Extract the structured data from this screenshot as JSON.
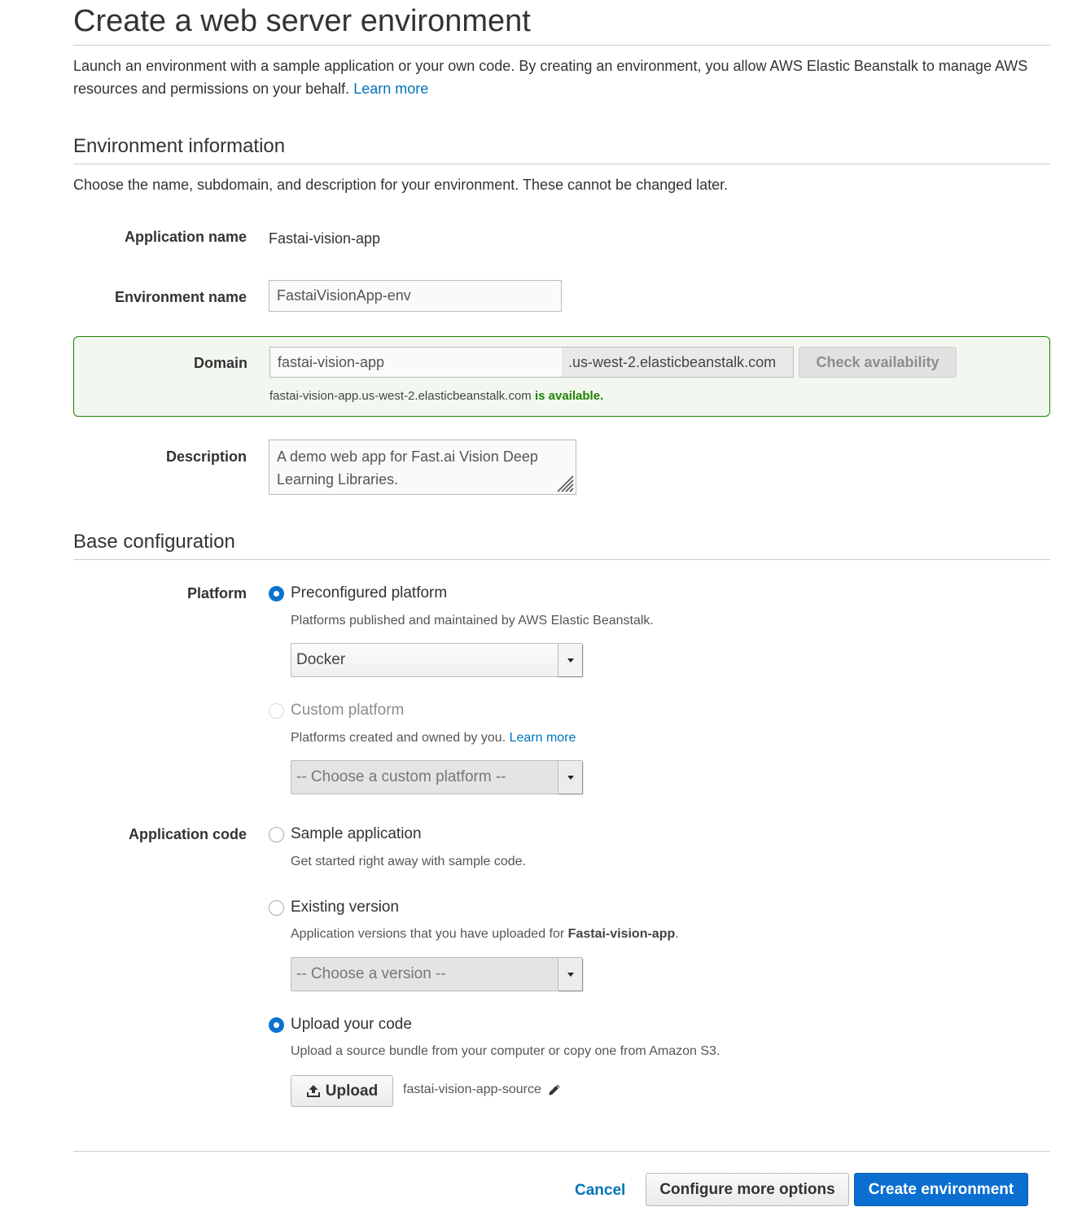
{
  "page": {
    "title": "Create a web server environment",
    "intro_text": "Launch an environment with a sample application or your own code. By creating an environment, you allow AWS Elastic Beanstalk to manage AWS resources and permissions on your behalf.",
    "intro_link": "Learn more"
  },
  "environment_info": {
    "heading": "Environment information",
    "description": "Choose the name, subdomain, and description for your environment. These cannot be changed later.",
    "application_name_label": "Application name",
    "application_name_value": "Fastai-vision-app",
    "environment_name_label": "Environment name",
    "environment_name_value": "FastaiVisionApp-env",
    "domain_label": "Domain",
    "domain_value": "fastai-vision-app",
    "domain_suffix": ".us-west-2.elasticbeanstalk.com",
    "check_availability_label": "Check availability",
    "availability_domain": "fastai-vision-app.us-west-2.elasticbeanstalk.com",
    "availability_status": "is available.",
    "description_label": "Description",
    "description_value": "A demo web app for Fast.ai Vision Deep Learning Libraries."
  },
  "base_config": {
    "heading": "Base configuration",
    "platform_label": "Platform",
    "preconfigured_label": "Preconfigured platform",
    "preconfigured_help": "Platforms published and maintained by AWS Elastic Beanstalk.",
    "preconfigured_select": "Docker",
    "custom_label": "Custom platform",
    "custom_help": "Platforms created and owned by you.",
    "custom_help_link": "Learn more",
    "custom_select": "-- Choose a custom platform --",
    "app_code_label": "Application code",
    "sample_label": "Sample application",
    "sample_help": "Get started right away with sample code.",
    "existing_label": "Existing version",
    "existing_help": "Application versions that you have uploaded for",
    "existing_help_app": "Fastai-vision-app",
    "existing_help_end": ".",
    "existing_select": "-- Choose a version --",
    "upload_label": "Upload your code",
    "upload_help": "Upload a source bundle from your computer or copy one from Amazon S3.",
    "upload_button": "Upload",
    "upload_filename": "fastai-vision-app-source"
  },
  "footer": {
    "cancel": "Cancel",
    "configure_more": "Configure more options",
    "create": "Create environment"
  },
  "icons": {
    "upload": "upload-icon",
    "edit": "pencil-icon",
    "resize": "resize-grip-icon",
    "dropdown": "caret-down-icon"
  },
  "colors": {
    "link": "#0073bb",
    "primary": "#0a6fd0",
    "success": "#1d8102",
    "radio_selected": "#0972d3"
  }
}
